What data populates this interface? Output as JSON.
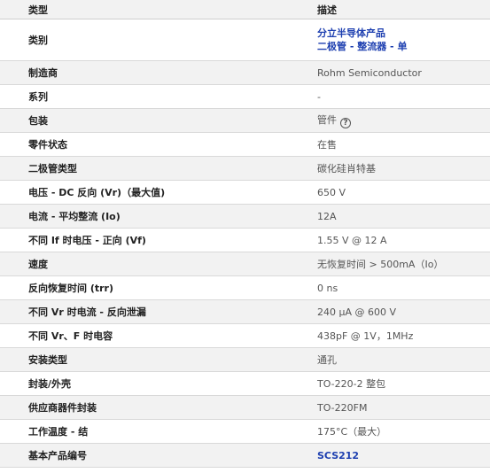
{
  "header": {
    "type_label": "类型",
    "desc_label": "描述"
  },
  "rows": [
    {
      "label": "类别",
      "value_lines": [
        "分立半导体产品",
        "二极管 - 整流器 - 单"
      ]
    },
    {
      "label": "制造商",
      "value": "Rohm Semiconductor"
    },
    {
      "label": "系列",
      "value": "-"
    },
    {
      "label": "包装",
      "value": "管件",
      "help_icon": "question-circle-icon"
    },
    {
      "label": "零件状态",
      "value": "在售"
    },
    {
      "label": "二极管类型",
      "value": "碳化硅肖特基"
    },
    {
      "label": "电压 - DC 反向 (Vr)（最大值)",
      "value": "650 V"
    },
    {
      "label": "电流 - 平均整流 (Io)",
      "value": "12A"
    },
    {
      "label": "不同 If 时电压 - 正向 (Vf)",
      "value": "1.55 V @ 12 A"
    },
    {
      "label": "速度",
      "value": "无恢复时间 > 500mA（Io）"
    },
    {
      "label": "反向恢复时间 (trr)",
      "value": "0 ns"
    },
    {
      "label": "不同 Vr 时电流 - 反向泄漏",
      "value": "240 µA @ 600 V"
    },
    {
      "label": "不同 Vr、F 时电容",
      "value": "438pF @ 1V，1MHz"
    },
    {
      "label": "安装类型",
      "value": "通孔"
    },
    {
      "label": "封装/外壳",
      "value": "TO-220-2 整包"
    },
    {
      "label": "供应商器件封装",
      "value": "TO-220FM"
    },
    {
      "label": "工作温度 - 结",
      "value": "175°C（最大）"
    },
    {
      "label": "基本产品编号",
      "value": "SCS212"
    }
  ],
  "colors": {
    "link": "#1d3fb0",
    "row_shade": "#f2f2f2",
    "divider": "#d9d9d9"
  }
}
